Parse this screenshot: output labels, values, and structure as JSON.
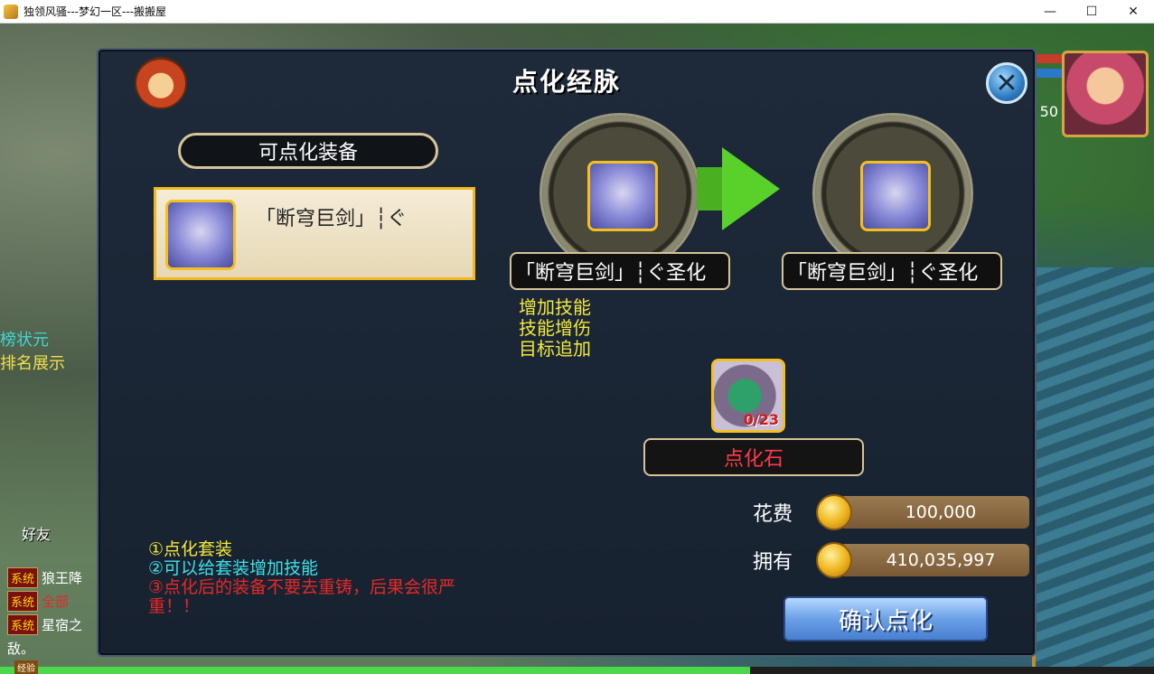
{
  "window": {
    "title": "独领风骚---梦幻一区---搬搬屋",
    "minimize_glyph": "—",
    "maximize_glyph": "☐",
    "close_glyph": "✕"
  },
  "hud": {
    "level": "50",
    "side_text_1": "榜状元",
    "side_text_2": "排名展示",
    "friend_label": "好友",
    "exp_label": "经验",
    "chat": [
      {
        "tag": "系统",
        "msg": "狼王降",
        "color": "#ffffff"
      },
      {
        "tag": "系统",
        "msg": "全部",
        "color": "#e82828"
      },
      {
        "tag": "系统",
        "msg": "星宿之",
        "color": "#ffffff"
      }
    ],
    "chat_tail": "敌。"
  },
  "dialog": {
    "title": "点化经脉",
    "close_glyph": "✕",
    "section_header": "可点化装备",
    "equip_name": "「断穹巨剑」┆ぐ",
    "before_name": "「断穹巨剑」┆ぐ圣化",
    "after_name": "「断穹巨剑」┆ぐ圣化",
    "effects": [
      "增加技能",
      "技能增伤",
      "目标追加"
    ],
    "stone_count": "0/23",
    "stone_label": "点化石",
    "cost_label": "花费",
    "cost_value": "100,000",
    "own_label": "拥有",
    "own_value": "410,035,997",
    "confirm_label": "确认点化",
    "notes": [
      "①点化套装",
      "②可以给套装增加技能",
      "③点化后的装备不要去重铸，后果会很严重！！"
    ]
  },
  "colors": {
    "accent_gold": "#f3c020",
    "effect_text": "#f4e93a",
    "stone_label": "#ff3a4a",
    "note_cyan": "#3fe0e8",
    "note_red": "#e82828"
  }
}
